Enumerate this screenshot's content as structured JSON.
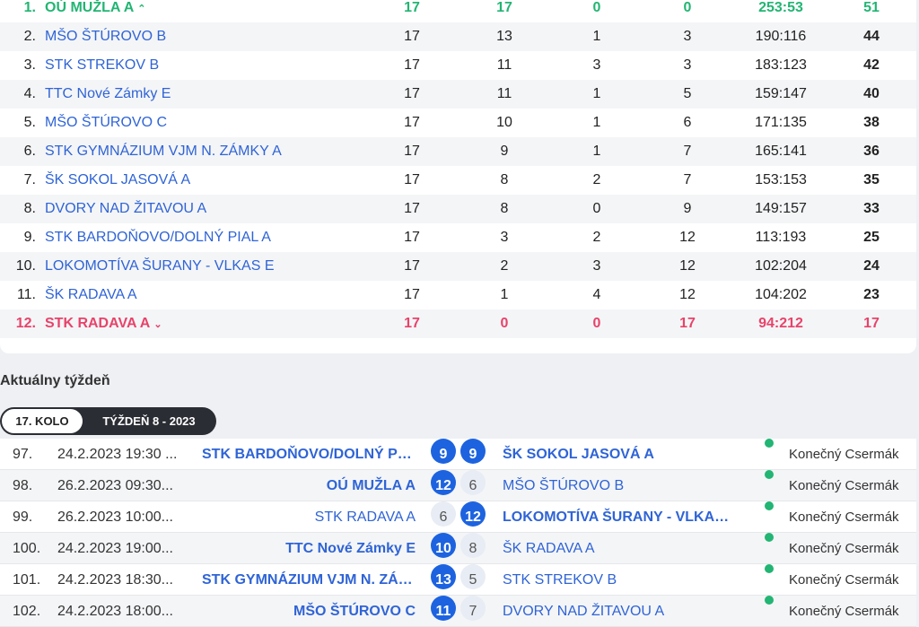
{
  "standings": {
    "rows": [
      {
        "rank": "1.",
        "team": "OÚ MUŽLA A",
        "p": "17",
        "w": "17",
        "d": "0",
        "l": "0",
        "score": "253:53",
        "pts": "51",
        "arrow": "⌃"
      },
      {
        "rank": "2.",
        "team": "MŠO ŠTÚROVO B",
        "p": "17",
        "w": "13",
        "d": "1",
        "l": "3",
        "score": "190:116",
        "pts": "44"
      },
      {
        "rank": "3.",
        "team": "STK STREKOV B",
        "p": "17",
        "w": "11",
        "d": "3",
        "l": "3",
        "score": "183:123",
        "pts": "42"
      },
      {
        "rank": "4.",
        "team": "TTC Nové Zámky E",
        "p": "17",
        "w": "11",
        "d": "1",
        "l": "5",
        "score": "159:147",
        "pts": "40"
      },
      {
        "rank": "5.",
        "team": "MŠO ŠTÚROVO C",
        "p": "17",
        "w": "10",
        "d": "1",
        "l": "6",
        "score": "171:135",
        "pts": "38"
      },
      {
        "rank": "6.",
        "team": "STK GYMNÁZIUM VJM N. ZÁMKY A",
        "p": "17",
        "w": "9",
        "d": "1",
        "l": "7",
        "score": "165:141",
        "pts": "36"
      },
      {
        "rank": "7.",
        "team": "ŠK SOKOL JASOVÁ A",
        "p": "17",
        "w": "8",
        "d": "2",
        "l": "7",
        "score": "153:153",
        "pts": "35"
      },
      {
        "rank": "8.",
        "team": "DVORY NAD ŽITAVOU A",
        "p": "17",
        "w": "8",
        "d": "0",
        "l": "9",
        "score": "149:157",
        "pts": "33"
      },
      {
        "rank": "9.",
        "team": "STK BARDOŇOVO/DOLNÝ PIAL A",
        "p": "17",
        "w": "3",
        "d": "2",
        "l": "12",
        "score": "113:193",
        "pts": "25"
      },
      {
        "rank": "10.",
        "team": "LOKOMOTÍVA ŠURANY - VLKAS E",
        "p": "17",
        "w": "2",
        "d": "3",
        "l": "12",
        "score": "102:204",
        "pts": "24"
      },
      {
        "rank": "11.",
        "team": "ŠK RADAVA A",
        "p": "17",
        "w": "1",
        "d": "4",
        "l": "12",
        "score": "104:202",
        "pts": "23"
      },
      {
        "rank": "12.",
        "team": "STK RADAVA A",
        "p": "17",
        "w": "0",
        "d": "0",
        "l": "17",
        "score": "94:212",
        "pts": "17",
        "arrow": "⌄"
      }
    ]
  },
  "week": {
    "title": "Aktuálny týždeň",
    "tab_round": "17. KOLO",
    "tab_week": "TÝŽDEŇ 8 - 2023"
  },
  "matches": [
    {
      "no": "97.",
      "date": "24.2.2023 19:30 ...",
      "home": "STK BARDOŇOVO/DOLNÝ PIAL A",
      "home_score": "9",
      "away_score": "9",
      "away": "ŠK SOKOL JASOVÁ A",
      "referee": "Konečný Csermák"
    },
    {
      "no": "98.",
      "date": "26.2.2023 09:30...",
      "home": "OÚ MUŽLA A",
      "home_score": "12",
      "away_score": "6",
      "away": "MŠO ŠTÚROVO B",
      "referee": "Konečný Csermák"
    },
    {
      "no": "99.",
      "date": "26.2.2023 10:00...",
      "home": "STK RADAVA A",
      "home_score": "6",
      "away_score": "12",
      "away": "LOKOMOTÍVA ŠURANY - VLKAS E",
      "referee": "Konečný Csermák"
    },
    {
      "no": "100.",
      "date": "24.2.2023 19:00...",
      "home": "TTC Nové Zámky E",
      "home_score": "10",
      "away_score": "8",
      "away": "ŠK RADAVA A",
      "referee": "Konečný Csermák"
    },
    {
      "no": "101.",
      "date": "24.2.2023 18:30...",
      "home": "STK GYMNÁZIUM VJM N. ZÁMKY A",
      "home_score": "13",
      "away_score": "5",
      "away": "STK STREKOV B",
      "referee": "Konečný Csermák"
    },
    {
      "no": "102.",
      "date": "24.2.2023 18:00...",
      "home": "MŠO ŠTÚROVO C",
      "home_score": "11",
      "away_score": "7",
      "away": "DVORY NAD ŽITAVOU A",
      "referee": "Konečný Csermák"
    }
  ],
  "colors": {
    "promotion": "#22b573",
    "relegation": "#e8436a",
    "link": "#2f64d6",
    "winner_badge": "#1d63e0",
    "status_dot": "#22b573"
  },
  "icons": {
    "up": "chevron-up-icon",
    "down": "chevron-down-icon",
    "status": "status-dot-icon"
  }
}
